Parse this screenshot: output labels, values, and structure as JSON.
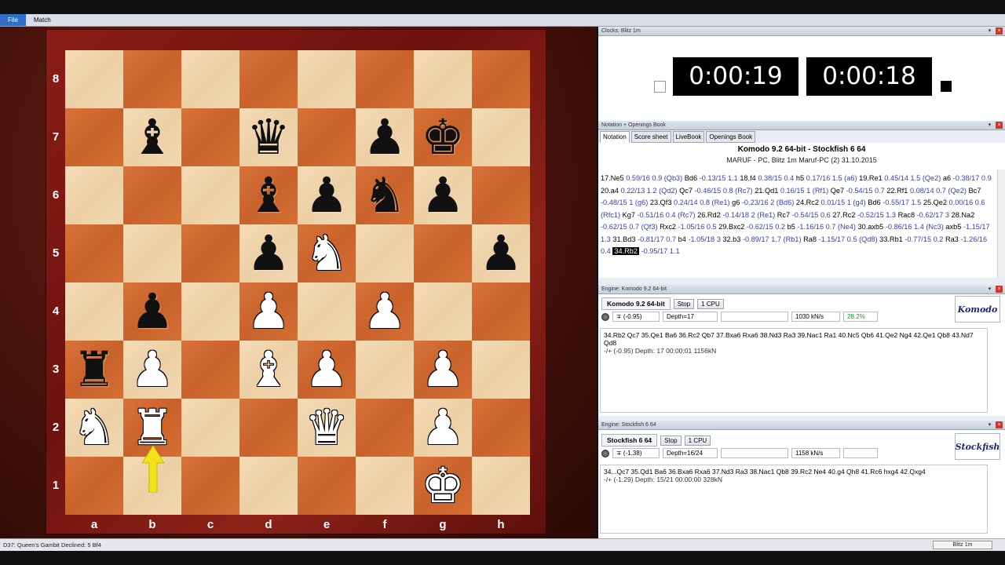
{
  "menubar": {
    "items": [
      "File",
      "Match"
    ]
  },
  "board": {
    "files": [
      "a",
      "b",
      "c",
      "d",
      "e",
      "f",
      "g",
      "h"
    ],
    "ranks": [
      "8",
      "7",
      "6",
      "5",
      "4",
      "3",
      "2",
      "1"
    ],
    "pieces": {
      "b7": "b-bishop",
      "d7": "b-queen",
      "f7": "b-pawn",
      "g7": "b-king",
      "d6": "b-bishop",
      "e6": "b-pawn",
      "f6": "b-knight",
      "g6": "b-pawn",
      "d5": "b-pawn",
      "e5": "w-knight",
      "h5": "b-pawn",
      "b4": "b-pawn",
      "d4": "w-pawn",
      "f4": "w-pawn",
      "a3": "b-rook",
      "b3": "w-pawn",
      "d3": "w-bishop",
      "e3": "w-pawn",
      "g3": "w-pawn",
      "a2": "w-knight",
      "b2": "w-rook",
      "e2": "w-queen",
      "g2": "w-pawn",
      "g1": "w-king"
    },
    "last_move_arrow": {
      "from": "b1",
      "to": "b2",
      "icon": "arrow-up-icon",
      "color": "#f2e21a"
    }
  },
  "clocks": {
    "title": "Clocks: Blitz 1m",
    "left_time": "0:00:19",
    "right_time": "0:00:18"
  },
  "notation": {
    "title": "Notation + Openings Book",
    "tabs": [
      "Notation",
      "Score sheet",
      "LiveBook",
      "Openings Book"
    ],
    "game_title": "Komodo 9.2 64-bit - Stockfish 6 64",
    "game_sub": "MARUF - PC, Blitz 1m Maruf-PC (2) 31.10.2015",
    "moves": [
      {
        "m": "17.Ne5",
        "e": "0.59/16 0.9 (Qb3)"
      },
      {
        "m": "Bd6",
        "e": "-0.13/15 1.1"
      },
      {
        "m": "18.f4",
        "e": "0.38/15 0.4"
      },
      {
        "m": "h5",
        "e": "0.17/16 1.5 (a6)"
      },
      {
        "m": "19.Re1",
        "e": "0.45/14 1.5 (Qe2)"
      },
      {
        "m": "a6",
        "e": "-0.38/17 0.9"
      },
      {
        "m": "20.a4",
        "e": "0.22/13 1.2 (Qd2)"
      },
      {
        "m": "Qc7",
        "e": "-0.46/15 0.8 (Rc7)"
      },
      {
        "m": "21.Qd1",
        "e": "0.16/15 1 (Rf1)"
      },
      {
        "m": "Qe7",
        "e": "-0.54/15 0.7"
      },
      {
        "m": "22.Rf1",
        "e": "0.08/14 0.7 (Qe2)"
      },
      {
        "m": "Bc7",
        "e": "-0.48/15 1 (g6)"
      },
      {
        "m": "23.Qf3",
        "e": "0.24/14 0.8 (Re1)"
      },
      {
        "m": "g6",
        "e": "-0.23/16 2 (Bd6)"
      },
      {
        "m": "24.Rc2",
        "e": "0.01/15 1 (g4)"
      },
      {
        "m": "Bd6",
        "e": "-0.55/17 1.5"
      },
      {
        "m": "25.Qe2",
        "e": "0.00/16 0.6 (Rfc1)"
      },
      {
        "m": "Kg7",
        "e": "-0.51/16 0.4 (Rc7)"
      },
      {
        "m": "26.Rd2",
        "e": "-0.14/18 2 (Re1)"
      },
      {
        "m": "Rc7",
        "e": "-0.54/15 0.6"
      },
      {
        "m": "27.Rc2",
        "e": "-0.52/15 1.3"
      },
      {
        "m": "Rac8",
        "e": "-0.62/17 3"
      },
      {
        "m": "28.Na2",
        "e": "-0.62/15 0.7 (Qf3)"
      },
      {
        "m": "Rxc2",
        "e": "-1.05/16 0.5"
      },
      {
        "m": "29.Bxc2",
        "e": "-0.62/15 0.2"
      },
      {
        "m": "b5",
        "e": "-1.16/16 0.7 (Ne4)"
      },
      {
        "m": "30.axb5",
        "e": "-0.86/16 1.4 (Nc3)"
      },
      {
        "m": "axb5",
        "e": "-1.15/17 1.3"
      },
      {
        "m": "31.Bd3",
        "e": "-0.81/17 0.7"
      },
      {
        "m": "b4",
        "e": "-1.05/18 3"
      },
      {
        "m": "32.b3",
        "e": "-0.89/17 1.7 (Rb1)"
      },
      {
        "m": "Ra8",
        "e": "-1.15/17 0.5 (Qd8)"
      },
      {
        "m": "33.Rb1",
        "e": "-0.77/15 0.2"
      },
      {
        "m": "Ra3",
        "e": "-1.26/16 0.4"
      },
      {
        "m": "34.Rb2",
        "e": "-0.95/17 1.1",
        "current": true
      }
    ]
  },
  "engine1": {
    "title": "Engine: Komodo 9.2 64-bit",
    "name": "Komodo 9.2 64-bit",
    "stop": "Stop",
    "cpu": "1 CPU",
    "eval": "∓ (-0.95)",
    "depth": "Depth=17",
    "move_field": "",
    "speed": "1030 kN/s",
    "percent": "28.2%",
    "logo": "Komodo",
    "line": "34.Rb2 Qc7 35.Qe1 Ba6 36.Rc2 Qb7 37.Bxa6 Rxa6 38.Nd3 Ra3 39.Nac1 Ra1 40.Nc5 Qb6 41.Qe2 Ng4 42.Qe1 Qb8 43.Nd7 Qd8",
    "info": "-/+  (-0.95)   Depth:  17   00:00:01  1156kN"
  },
  "engine2": {
    "title": "Engine: Stockfish 6 64",
    "name": "Stockfish 6 64",
    "stop": "Stop",
    "cpu": "1 CPU",
    "eval": "∓ (-1.38)",
    "depth": "Depth=16/24",
    "move_field": "",
    "speed": "1158 kN/s",
    "percent": "",
    "logo": "Stockfish",
    "line": "34...Qc7 35.Qd1 Ba6 36.Bxa6 Rxa6 37.Nd3 Ra3 38.Nac1 Qb8 39.Rc2 Ne4 40.g4 Qh8 41.Rc6 hxg4 42.Qxg4",
    "info": "-/+  (-1.29)   Depth:  15/21   00:00:00  328kN"
  },
  "status": {
    "left": "D37: Queen's Gambit Declined: 5 Bf4",
    "right": "Blitz 1m"
  }
}
